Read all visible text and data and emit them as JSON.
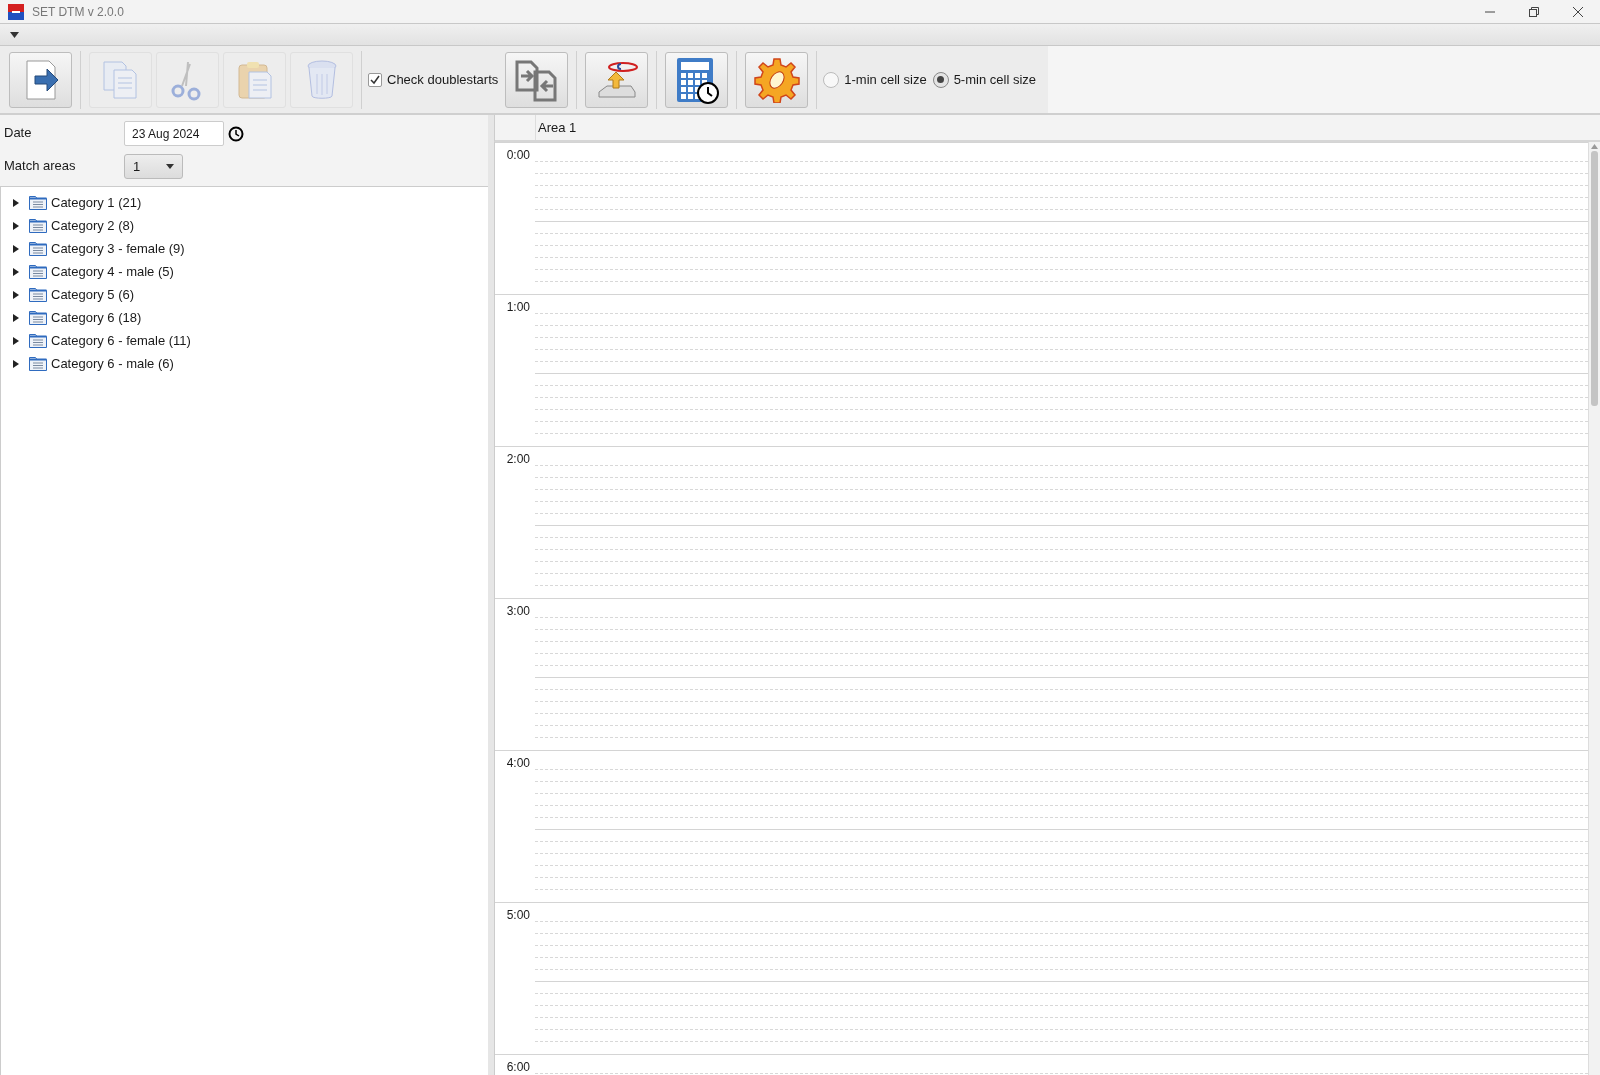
{
  "window": {
    "title": "SET DTM v 2.0.0"
  },
  "toolbar": {
    "buttons": [
      {
        "kind": "export",
        "disabled": false
      },
      {
        "kind": "copy",
        "disabled": true
      },
      {
        "kind": "cut",
        "disabled": true
      },
      {
        "kind": "paste",
        "disabled": true
      },
      {
        "kind": "delete",
        "disabled": true
      },
      {
        "kind": "checkbox",
        "label": "Check doublestarts",
        "checked": true
      },
      {
        "kind": "swap",
        "disabled": false
      },
      {
        "kind": "upload",
        "disabled": false
      },
      {
        "kind": "calculator",
        "disabled": false
      },
      {
        "kind": "settings",
        "disabled": false
      }
    ],
    "cell_size": [
      {
        "label": "1-min cell size",
        "selected": false
      },
      {
        "label": "5-min cell size",
        "selected": true
      }
    ]
  },
  "form": {
    "date_label": "Date",
    "date_value": "23 Aug 2024",
    "areas_label": "Match areas",
    "areas_value": "1"
  },
  "tree": [
    {
      "label": "Category 1 (21)",
      "expanded": false
    },
    {
      "label": "Category 2 (8)",
      "expanded": false
    },
    {
      "label": "Category 3 - female (9)",
      "expanded": false
    },
    {
      "label": "Category 4 - male (5)",
      "expanded": false
    },
    {
      "label": "Category 5 (6)",
      "expanded": false
    },
    {
      "label": "Category 6 (18)",
      "expanded": false
    },
    {
      "label": "Category 6 - female (11)",
      "expanded": false
    },
    {
      "label": "Category 6 - male (6)",
      "expanded": false
    }
  ],
  "schedule": {
    "columns": [
      "Area 1"
    ],
    "hours": [
      "0:00",
      "1:00",
      "2:00",
      "3:00",
      "4:00",
      "5:00",
      "6:00"
    ]
  }
}
